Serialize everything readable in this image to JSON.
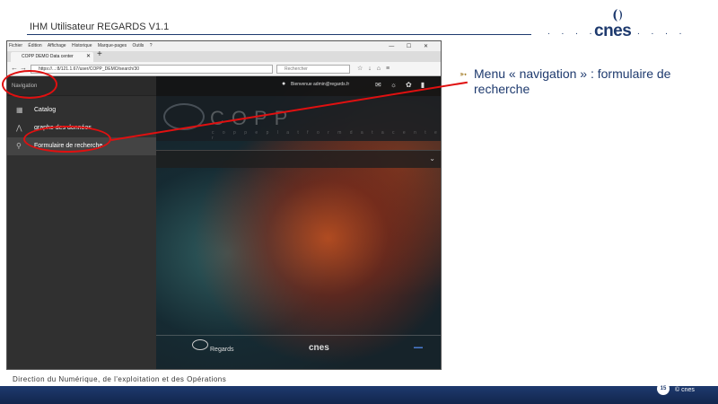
{
  "slide": {
    "title": "IHM Utilisateur REGARDS V1.1",
    "logo": "cnes",
    "logo_dots": ". . . .",
    "bullet": "Menu « navigation » : formulaire de recherche",
    "footer": "Direction du Numérique, de l'exploitation et des Opérations",
    "page_number": "15",
    "footer_logo": "© cnes"
  },
  "browser": {
    "menu": [
      "Fichier",
      "Édition",
      "Affichage",
      "Historique",
      "Marque-pages",
      "Outils",
      "?"
    ],
    "tab_title": "COPP DEMO Data center",
    "url": "https://...:8/121.1.67/user/COPP_DEMO/search/30",
    "search_placeholder": "Rechercher",
    "win_controls": "— ☐ ✕"
  },
  "app": {
    "sidebar_header": "Navigation",
    "sidebar_items": [
      {
        "label": "Catalog",
        "icon": "catalog-icon"
      },
      {
        "label": "graphe des données",
        "icon": "graph-icon"
      },
      {
        "label": "Formulaire de recherche",
        "icon": "search-icon"
      }
    ],
    "user": "Bienvenue admin@regards.fr",
    "logo_text": "COPP",
    "logo_sub": "c o p p e   p l a t f o r m   d a t a   c e n t e r",
    "footer_regards": "Regards",
    "footer_cnes": "cnes"
  },
  "colors": {
    "annotation": "#e01010",
    "brand": "#1e3a6e"
  }
}
